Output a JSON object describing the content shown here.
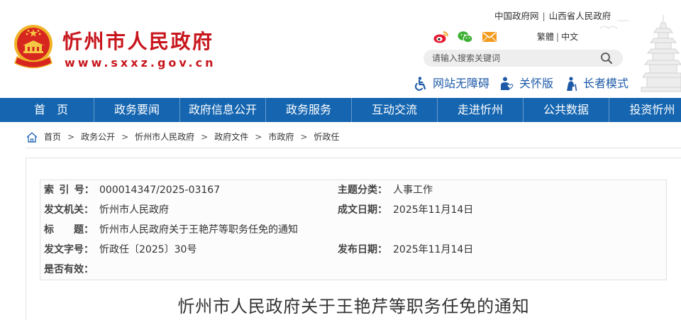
{
  "header": {
    "site_title": "忻州市人民政府",
    "site_url": "www.sxxz.gov.cn",
    "logo_icon": "national-emblem",
    "top_links": {
      "items": [
        "中国政府网",
        "山西省人民政府"
      ],
      "divider": "|"
    },
    "social_icons": [
      "weibo-icon",
      "wechat-icon",
      "mail-icon"
    ],
    "language": {
      "traditional": "繁體",
      "divider": "|",
      "simplified": "中文"
    },
    "search": {
      "placeholder": "请输入搜索关键词",
      "icon": "search-icon"
    },
    "accessibility": [
      {
        "label": "网站无障碍",
        "icon": "wheelchair-icon"
      },
      {
        "label": "关怀版",
        "icon": "care-mode-icon"
      },
      {
        "label": "长者模式",
        "icon": "elder-mode-icon"
      }
    ]
  },
  "nav": {
    "items": [
      "首　页",
      "政务要闻",
      "政府信息公开",
      "政务服务",
      "互动交流",
      "走进忻州",
      "公共数据",
      "投资忻州"
    ]
  },
  "breadcrumb": {
    "icon": "home-icon",
    "separator": ">",
    "items": [
      "首页",
      "政务公开",
      "忻州市人民政府",
      "政府文件",
      "市政府",
      "忻政任"
    ]
  },
  "document_meta": {
    "index_no": {
      "label": "索 引 号：",
      "value": "000014347/2025-03167"
    },
    "category": {
      "label": "主题分类：",
      "value": "人事工作"
    },
    "issuer": {
      "label": "发文机关：",
      "value": "忻州市人民政府"
    },
    "written_date": {
      "label": "成文日期：",
      "value": "2025年11月14日"
    },
    "title": {
      "label": "标　　题：",
      "value": "忻州市人民政府关于王艳芹等职务任免的通知"
    },
    "doc_no": {
      "label": "发文字号：",
      "value": "忻政任〔2025〕30号"
    },
    "publish_date": {
      "label": "发布日期：",
      "value": "2025年11月14日"
    },
    "validity": {
      "label": "是否有效：",
      "value": ""
    }
  },
  "document": {
    "title": "忻州市人民政府关于王艳芹等职务任免的通知"
  },
  "colors": {
    "brand_red": "#c8161d",
    "nav_blue": "#1565b0",
    "link_blue": "#1e5aa8"
  }
}
